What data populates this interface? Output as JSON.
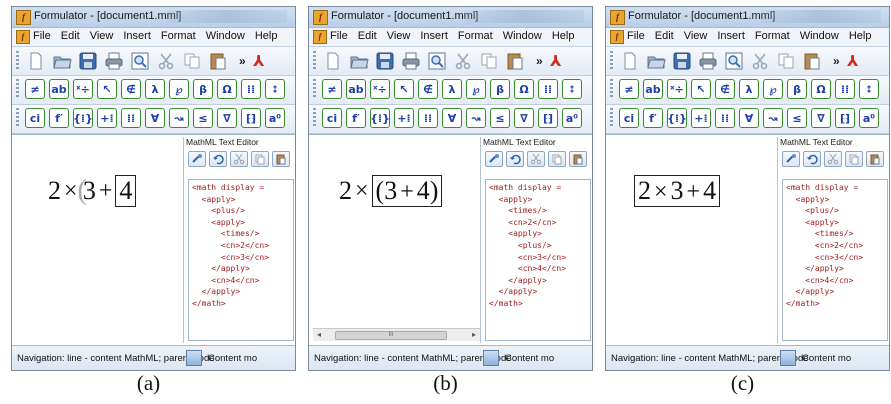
{
  "app": {
    "title": "Formulator - [document1.mml]",
    "icon_letter": "f"
  },
  "menu": [
    "File",
    "Edit",
    "View",
    "Insert",
    "Format",
    "Window",
    "Help"
  ],
  "toolbar_file_icons": [
    "new-document-icon",
    "open-folder-icon",
    "save-disk-icon",
    "print-icon",
    "zoom-view-icon",
    "cut-scissors-icon",
    "copy-icon",
    "paste-icon"
  ],
  "toolbar_overflow": "»",
  "toolbar_pdf_icon": "adobe-pdf-icon",
  "toolbar_row2_labels": [
    "≠",
    "ab",
    "ˣ÷",
    "↖",
    "∉",
    "λ",
    "℘",
    "β",
    "Ω",
    "⁞⁞",
    "⦂"
  ],
  "toolbar_row3_labels": [
    "ci",
    "f′",
    "{⁞}",
    "+⁞",
    "⁞⁞",
    "∀",
    "↝",
    "≤",
    "∇",
    "⁅⁆",
    "a⁰"
  ],
  "editor": {
    "title": "MathML Text Editor",
    "button_icons": [
      "link-icon",
      "undo-icon",
      "cut-icon",
      "copy-icon",
      "paste-icon"
    ]
  },
  "panels": [
    {
      "caption": "(a)",
      "expr": {
        "a": "2",
        "op1": "×",
        "b": "3",
        "op2": "+",
        "c": "4"
      },
      "code": [
        "<math display =",
        "  <apply>",
        "    <plus/>",
        "    <apply>",
        "      <times/>",
        "      <cn>2</cn>",
        "      <cn>3</cn>",
        "    </apply>",
        "    <cn>4</cn>",
        "  </apply>",
        "</math>"
      ]
    },
    {
      "caption": "(b)",
      "expr": {
        "a": "2",
        "op1": "×",
        "b": "(3",
        "op2": "+",
        "c": "4)"
      },
      "code": [
        "<math display =",
        "  <apply>",
        "    <times/>",
        "    <cn>2</cn>",
        "    <apply>",
        "      <plus/>",
        "      <cn>3</cn>",
        "      <cn>4</cn>",
        "    </apply>",
        "  </apply>",
        "</math>"
      ],
      "scrollbar_thumb": "III"
    },
    {
      "caption": "(c)",
      "expr": {
        "a": "2",
        "op1": "×",
        "b": "3",
        "op2": "+",
        "c": "4"
      },
      "code": [
        "<math display =",
        "  <apply>",
        "    <plus/>",
        "    <apply>",
        "      <times/>",
        "      <cn>2</cn>",
        "      <cn>3</cn>",
        "    </apply>",
        "    <cn>4</cn>",
        "  </apply>",
        "</math>"
      ]
    }
  ],
  "status": {
    "text": "Navigation: line - content MathML; parent node",
    "text_right": "Content mo"
  }
}
